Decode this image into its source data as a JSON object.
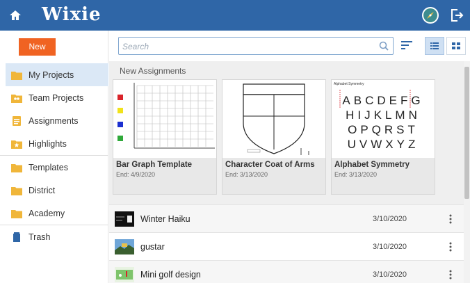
{
  "app": {
    "logo": "Wixie",
    "colors": {
      "topbar": "#2f66a7",
      "accent": "#f06322",
      "selected": "#dbe8f6"
    },
    "icons": {
      "home": "home-icon",
      "avatar": "compass-avatar-icon",
      "exit": "sign-out-icon"
    }
  },
  "sidebar": {
    "new_label": "New",
    "items": [
      {
        "label": "My Projects",
        "icon": "folder-icon"
      },
      {
        "label": "Team Projects",
        "icon": "team-folder-icon"
      },
      {
        "label": "Assignments",
        "icon": "clipboard-icon"
      },
      {
        "label": "Highlights",
        "icon": "star-folder-icon"
      },
      {
        "label": "Templates",
        "icon": "folder-icon"
      },
      {
        "label": "District",
        "icon": "folder-icon"
      },
      {
        "label": "Academy",
        "icon": "folder-icon"
      },
      {
        "label": "Trash",
        "icon": "trash-icon"
      }
    ]
  },
  "search": {
    "placeholder": "Search",
    "value": ""
  },
  "assignments": {
    "heading": "New Assignments",
    "cards": [
      {
        "title": "Bar Graph Template",
        "date": "End: 4/9/2020"
      },
      {
        "title": "Character Coat of Arms",
        "date": "End: 3/13/2020"
      },
      {
        "title": "Alphabet Symmetry",
        "date": "End: 3/13/2020",
        "thumb_caption": "Alphabet Symmetry",
        "letter_rows": [
          "ABCDEFG",
          "HIJKLMN",
          "OPQRST",
          "UVWXYZ"
        ]
      }
    ]
  },
  "projects": [
    {
      "name": "Winter Haiku",
      "date": "3/10/2020"
    },
    {
      "name": "gustar",
      "date": "3/10/2020"
    },
    {
      "name": "Mini golf design",
      "date": "3/10/2020"
    }
  ]
}
